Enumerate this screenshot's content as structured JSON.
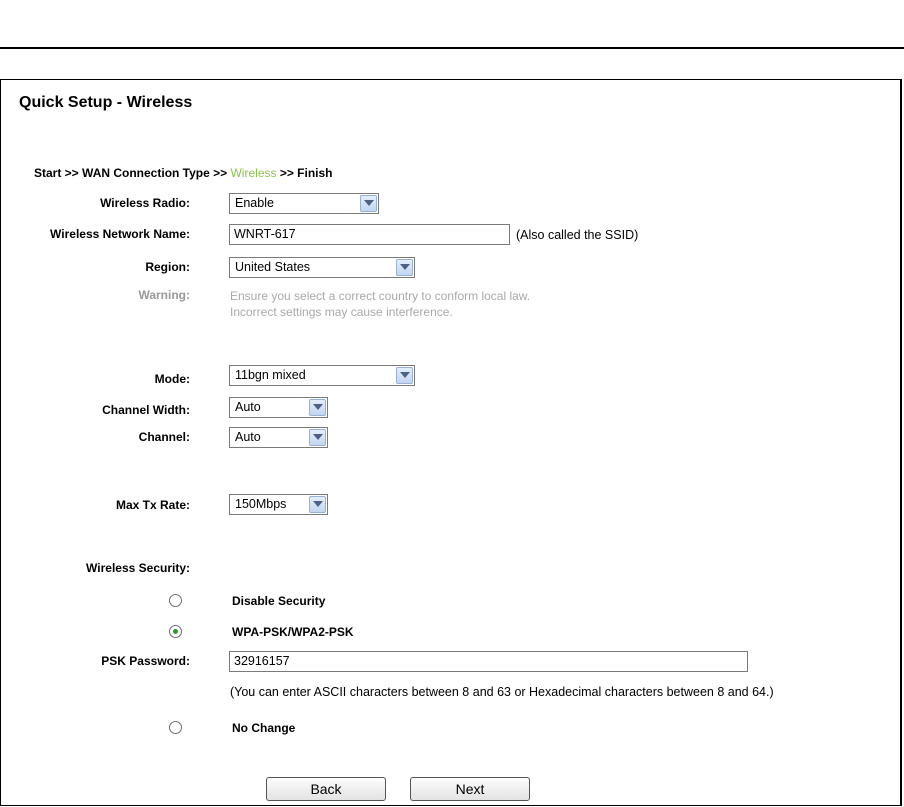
{
  "page": {
    "title": "Quick Setup - Wireless",
    "breadcrumb": {
      "before": "Start >> WAN Connection Type >> ",
      "current": "Wireless",
      "after": " >> Finish"
    }
  },
  "form": {
    "wireless_radio": {
      "label": "Wireless Radio:",
      "value": "Enable"
    },
    "network_name": {
      "label": "Wireless Network Name:",
      "value": "WNRT-617",
      "note": "(Also called the SSID)"
    },
    "region": {
      "label": "Region:",
      "value": "United States"
    },
    "warning": {
      "label": "Warning:",
      "line1": "Ensure you select a correct country to conform local law.",
      "line2": "Incorrect settings may cause interference."
    },
    "mode": {
      "label": "Mode:",
      "value": "11bgn mixed"
    },
    "channel_width": {
      "label": "Channel Width:",
      "value": "Auto"
    },
    "channel": {
      "label": "Channel:",
      "value": "Auto"
    },
    "max_tx_rate": {
      "label": "Max Tx Rate:",
      "value": "150Mbps"
    },
    "security": {
      "label": "Wireless Security:",
      "options": [
        {
          "label": "Disable Security",
          "selected": false
        },
        {
          "label": "WPA-PSK/WPA2-PSK",
          "selected": true
        },
        {
          "label": "No Change",
          "selected": false
        }
      ],
      "psk_label": "PSK Password:",
      "psk_value": "32916157",
      "psk_hint": "(You can enter ASCII characters between 8 and 63 or Hexadecimal characters between 8 and 64.)"
    }
  },
  "buttons": {
    "back": "Back",
    "next": "Next"
  },
  "colors": {
    "breadcrumb_current": "#8bc34a",
    "warning_text": "#a9a9a9",
    "radio_checked": "#2b9a2b"
  }
}
